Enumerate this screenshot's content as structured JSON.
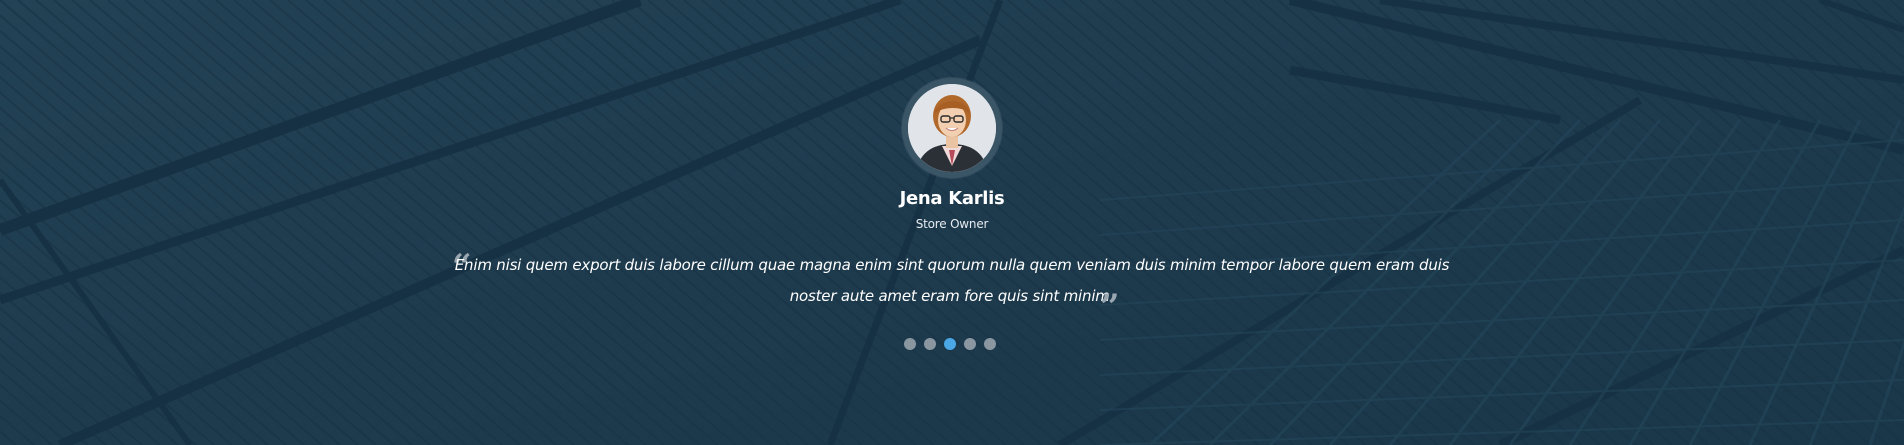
{
  "testimonial": {
    "name": "Jena Karlis",
    "role": "Store Owner",
    "quote": "Enim nisi quem export duis labore cillum quae magna enim sint quorum nulla quem veniam duis minim tempor labore quem eram duis noster aute amet eram fore quis sint minim.",
    "open_quote_icon": "quote-open-icon",
    "close_quote_icon": "quote-close-icon"
  },
  "pager": {
    "count": 5,
    "active_index": 2
  },
  "colors": {
    "background": "#1f3d51",
    "active_dot": "#4aa8e6",
    "inactive_dot": "#8a97a1",
    "text": "#ffffff"
  }
}
